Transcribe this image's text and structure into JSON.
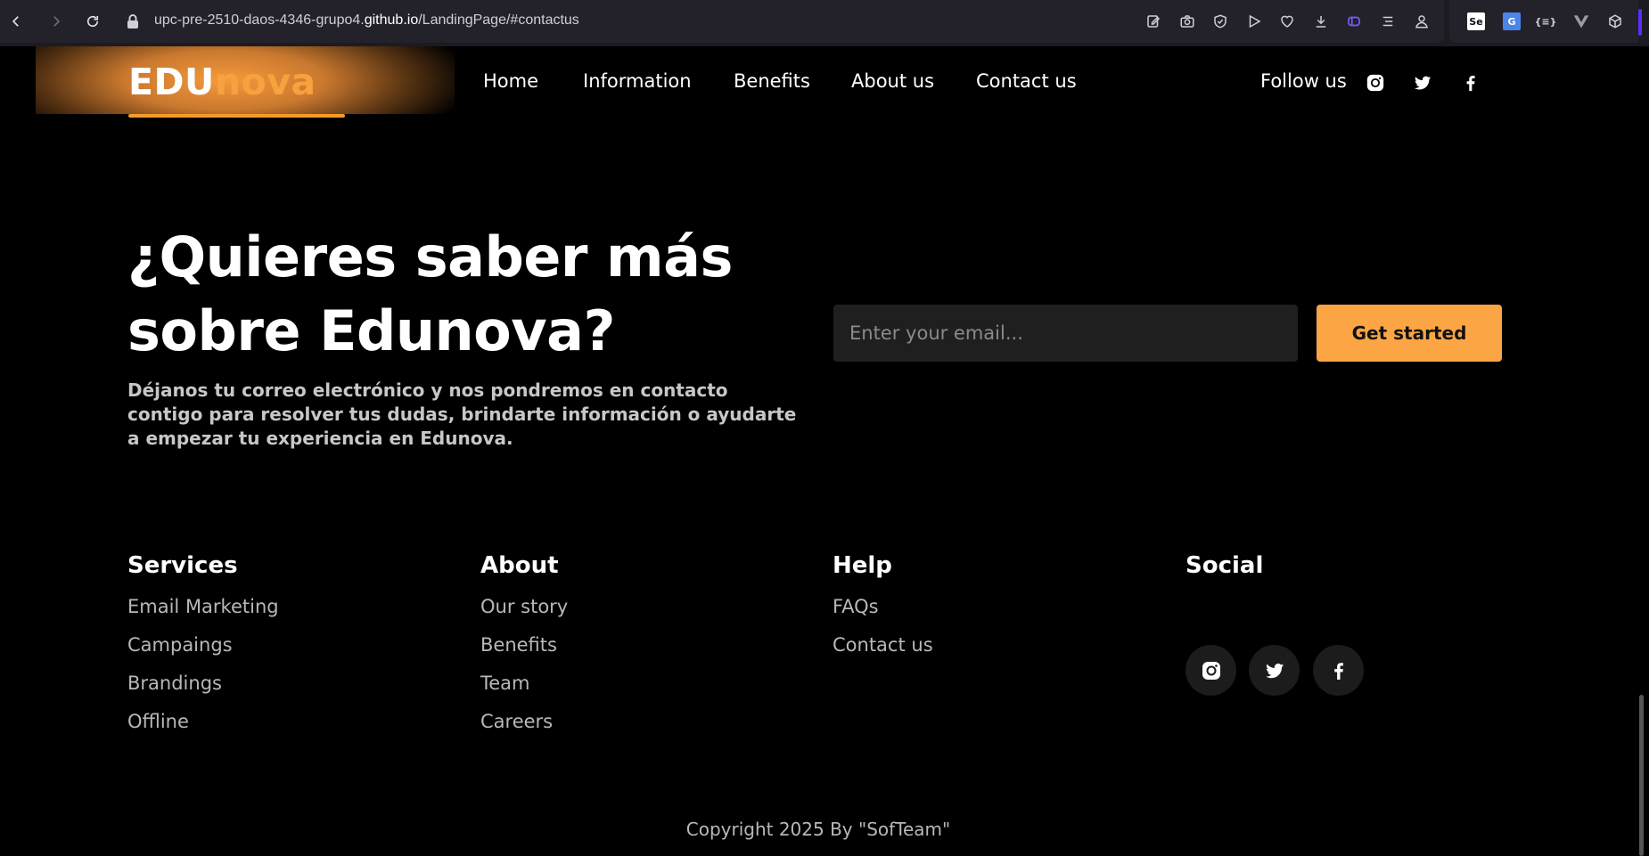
{
  "browser": {
    "url_prefix": "upc-pre-2510-daos-4346-grupo4.",
    "url_domain": "github.io",
    "url_path": "/LandingPage/#contactus",
    "ext_se_label": "Se",
    "ext_json_label": "{≡}"
  },
  "header": {
    "logo_edu": "EDU",
    "logo_nova": "nova",
    "nav": [
      "Home",
      "Information",
      "Benefits",
      "About us",
      "Contact us"
    ],
    "follow_label": "Follow us"
  },
  "hero": {
    "title_line1": "¿Quieres saber más",
    "title_line2": "sobre Edunova?",
    "description": "Déjanos tu correo electrónico y nos pondremos en contacto contigo para resolver tus dudas, brindarte información o ayudarte a empezar tu experiencia en Edunova.",
    "email_placeholder": "Enter your email...",
    "cta_label": "Get started"
  },
  "footer": {
    "services": {
      "title": "Services",
      "links": [
        "Email Marketing",
        "Campaings",
        "Brandings",
        "Offline"
      ]
    },
    "about": {
      "title": "About",
      "links": [
        "Our story",
        "Benefits",
        "Team",
        "Careers"
      ]
    },
    "help": {
      "title": "Help",
      "links": [
        "FAQs",
        "Contact us"
      ]
    },
    "social": {
      "title": "Social",
      "icons": [
        "instagram-icon",
        "twitter-icon",
        "facebook-icon"
      ]
    },
    "copyright": "Copyright 2025 By \"SofTeam\""
  },
  "colors": {
    "accent": "#fca544",
    "logo_nova": "#f7a13f",
    "background": "#000000",
    "input_bg": "#1f1f1f",
    "social_circle_bg": "#1c1c1c"
  }
}
